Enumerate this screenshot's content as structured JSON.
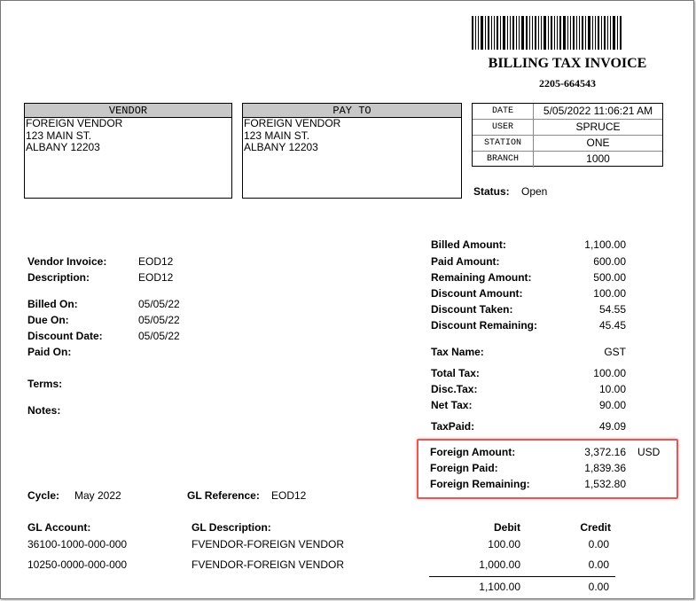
{
  "header": {
    "title": "BILLING TAX INVOICE",
    "number": "2205-664543"
  },
  "vendor": {
    "heading": "VENDOR",
    "lines": [
      "FOREIGN VENDOR",
      "123 MAIN ST.",
      "ALBANY 12203"
    ]
  },
  "payto": {
    "heading": "PAY TO",
    "lines": [
      "FOREIGN VENDOR",
      "123 MAIN ST.",
      "ALBANY 12203"
    ]
  },
  "info": [
    {
      "label": "DATE",
      "value": "5/05/2022 11:06:21 AM"
    },
    {
      "label": "USER",
      "value": "SPRUCE"
    },
    {
      "label": "STATION",
      "value": "ONE"
    },
    {
      "label": "BRANCH",
      "value": "1000"
    }
  ],
  "status": {
    "label": "Status:",
    "value": "Open"
  },
  "details": [
    {
      "label": "Vendor Invoice:",
      "value": "EOD12"
    },
    {
      "label": "Description:",
      "value": "EOD12"
    },
    {
      "label": "Billed On:",
      "value": "05/05/22"
    },
    {
      "label": "Due On:",
      "value": "05/05/22"
    },
    {
      "label": "Discount Date:",
      "value": "05/05/22"
    },
    {
      "label": "Paid On:",
      "value": ""
    },
    {
      "label": "Terms:",
      "value": ""
    },
    {
      "label": "Notes:",
      "value": ""
    }
  ],
  "amounts": [
    {
      "label": "Billed Amount:",
      "value": "1,100.00"
    },
    {
      "label": "Paid Amount:",
      "value": "600.00"
    },
    {
      "label": "Remaining Amount:",
      "value": "500.00"
    },
    {
      "label": "Discount Amount:",
      "value": "100.00"
    },
    {
      "label": "Discount Taken:",
      "value": "54.55"
    },
    {
      "label": "Discount Remaining:",
      "value": "45.45"
    },
    {
      "label": "Tax Name:",
      "value": "GST"
    },
    {
      "label": "Total Tax:",
      "value": "100.00"
    },
    {
      "label": "Disc.Tax:",
      "value": "10.00"
    },
    {
      "label": "Net Tax:",
      "value": "90.00"
    },
    {
      "label": "TaxPaid:",
      "value": "49.09"
    }
  ],
  "foreign": {
    "currency": "USD",
    "rows": [
      {
        "label": "Foreign Amount:",
        "value": "3,372.16"
      },
      {
        "label": "Foreign Paid:",
        "value": "1,839.36"
      },
      {
        "label": "Foreign Remaining:",
        "value": "1,532.80"
      }
    ],
    "highlight_color": "#e05a5a"
  },
  "cycle": {
    "label": "Cycle:",
    "value": "May 2022"
  },
  "gl_reference": {
    "label": "GL Reference:",
    "value": "EOD12"
  },
  "gl_table": {
    "headers": {
      "account": "GL Account:",
      "description": "GL Description:",
      "debit": "Debit",
      "credit": "Credit"
    },
    "rows": [
      {
        "account": "36100-1000-000-000",
        "description": "FVENDOR-FOREIGN VENDOR",
        "debit": "100.00",
        "credit": "0.00"
      },
      {
        "account": "10250-0000-000-000",
        "description": "FVENDOR-FOREIGN VENDOR",
        "debit": "1,000.00",
        "credit": "0.00"
      }
    ],
    "totals": {
      "debit": "1,100.00",
      "credit": "0.00"
    }
  }
}
